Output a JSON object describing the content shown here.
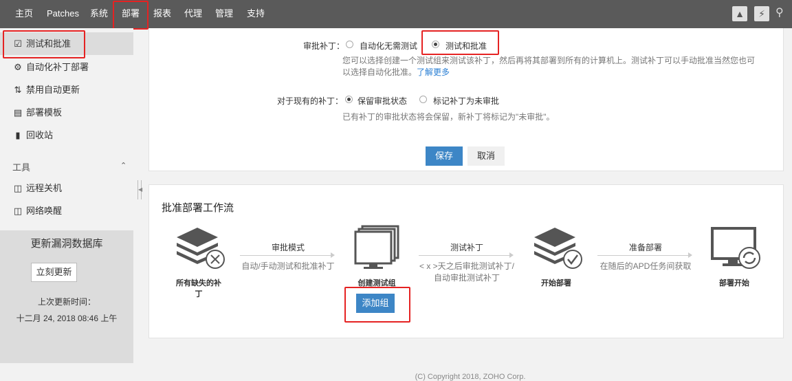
{
  "nav": {
    "items": [
      "主页",
      "Patches",
      "系统",
      "部署",
      "报表",
      "代理",
      "管理",
      "支持"
    ],
    "active": "部署"
  },
  "sidebar": {
    "items": [
      {
        "label": "测试和批准",
        "icon": "checkbox-icon"
      },
      {
        "label": "自动化补丁部署",
        "icon": "gear-icon"
      },
      {
        "label": "禁用自动更新",
        "icon": "disabled-sync-icon"
      },
      {
        "label": "部署模板",
        "icon": "template-icon"
      },
      {
        "label": "回收站",
        "icon": "trash-icon"
      }
    ],
    "tools_title": "工具",
    "tools": [
      {
        "label": "远程关机",
        "icon": "monitor-power-icon"
      },
      {
        "label": "网络唤醒",
        "icon": "monitor-power-icon"
      }
    ],
    "update": {
      "title": "更新漏洞数据库",
      "button": "立刻更新",
      "last_label": "上次更新时间：",
      "last_time": "十二月 24, 2018 08:46 上午"
    }
  },
  "settings": {
    "approval_label": "审批补丁：",
    "option_auto": "自动化无需测试",
    "option_test": "测试和批准",
    "selected": "测试和批准",
    "hint_line1": "您可以选择创建一个测试组来测试该补丁，然后再将其部署到所有的计算机上。测试补丁可以手动批准当然您也可",
    "hint_line2": "以选择自动化批准。",
    "learn_more": "了解更多",
    "existing_label": "对于现有的补丁：",
    "existing_keep": "保留审批状态",
    "existing_mark": "标记补丁为未审批",
    "existing_selected": "保留审批状态",
    "existing_hint": "已有补丁的审批状态将会保留，新补丁将标记为\"未审批\"。",
    "save": "保存",
    "cancel": "取消"
  },
  "workflow": {
    "title": "批准部署工作流",
    "steps": [
      {
        "label_l1": "所有缺失的补",
        "label_l2": "丁",
        "icon": "layers-x-icon"
      },
      {
        "label_l1": "创建测试组",
        "label_l2": "",
        "icon": "stacked-monitor-icon"
      },
      {
        "label_l1": "开始部署",
        "label_l2": "",
        "icon": "layers-check-icon"
      },
      {
        "label_l1": "部署开始",
        "label_l2": "",
        "icon": "monitor-refresh-icon"
      }
    ],
    "arrows": [
      {
        "title": "审批模式",
        "sub_l1": "自动/手动测试和批准补丁",
        "sub_l2": ""
      },
      {
        "title": "测试补丁",
        "sub_l1": "< x >天之后审批测试补丁/",
        "sub_l2": "自动审批测试补丁"
      },
      {
        "title": "准备部署",
        "sub_l1": "在随后的APD任务间获取",
        "sub_l2": ""
      }
    ],
    "add_group": "添加组"
  },
  "footer": "(C) Copyright 2018, ZOHO Corp."
}
